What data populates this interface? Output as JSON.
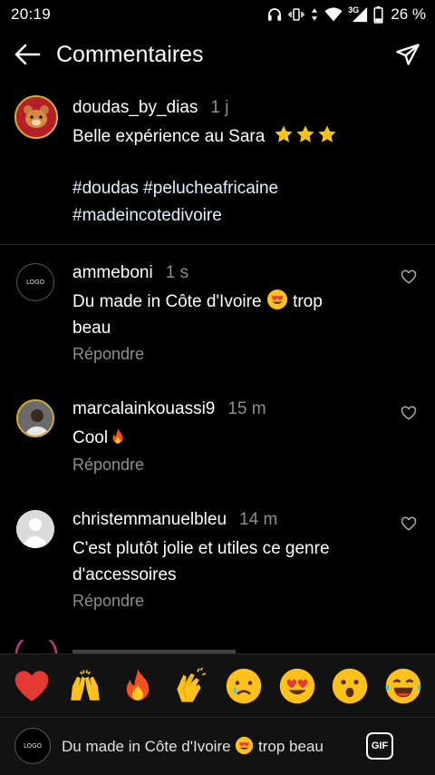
{
  "status_bar": {
    "time": "20:19",
    "network": "3G",
    "battery": "26 %"
  },
  "header": {
    "title": "Commentaires"
  },
  "caption": {
    "username": "doudas_by_dias",
    "time_ago": "1 j",
    "text": "Belle expérience au Sara",
    "hashtags_line1": "#doudas #pelucheafricaine",
    "hashtags_line2": "#madeincotedivoire"
  },
  "comments": [
    {
      "username": "ammeboni",
      "time_ago": "1 s",
      "text_line1": "Du made in Côte d'Ivoire",
      "text_line1_after": "trop",
      "text_line2": "beau",
      "reply_label": "Répondre",
      "avatar_label": "LOGO"
    },
    {
      "username": "marcalainkouassi9",
      "time_ago": "15 m",
      "text": "Cool",
      "reply_label": "Répondre"
    },
    {
      "username": "christemmanuelbleu",
      "time_ago": "14 m",
      "text_line1": "C'est plutôt jolie et utiles ce genre",
      "text_line2": "d'accessoires",
      "reply_label": "Répondre"
    }
  ],
  "emoji_bar": [
    "heart",
    "raising-hands",
    "fire",
    "clapping-hands",
    "crying-face",
    "heart-eyes",
    "astonished-face",
    "tears-of-joy"
  ],
  "input": {
    "value_before": "Du made in Côte d'Ivoire",
    "value_after": "trop beau",
    "gif_label": "GIF",
    "avatar_label": "LOGO"
  }
}
